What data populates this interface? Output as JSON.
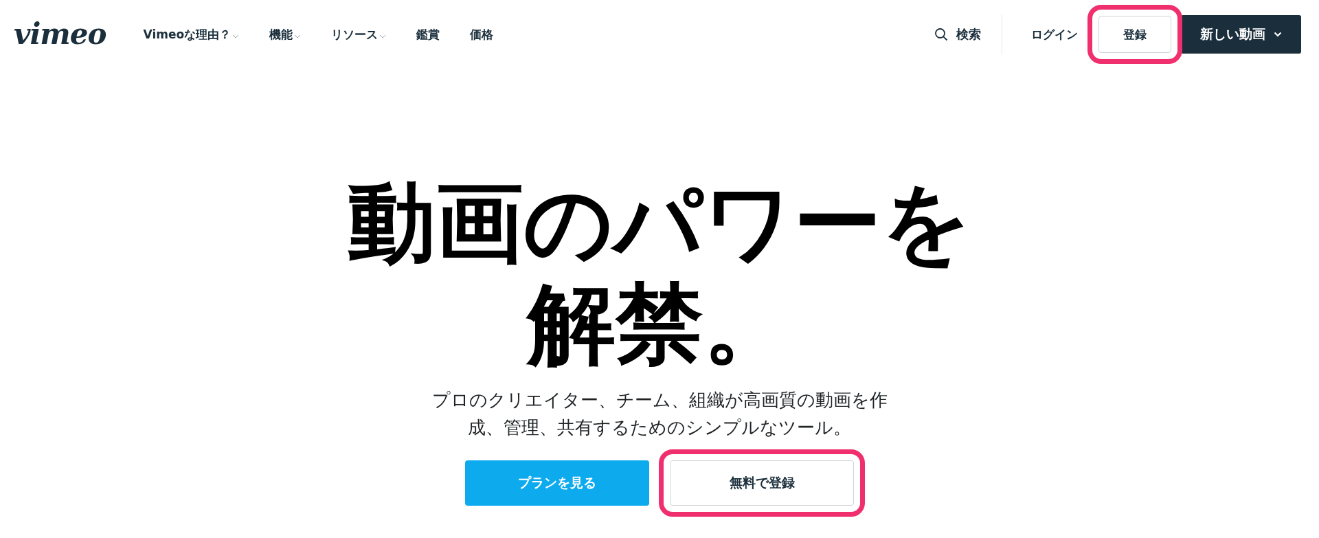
{
  "header": {
    "logo": "vimeo",
    "nav": [
      {
        "label": "Vimeoな理由？",
        "dropdown": true
      },
      {
        "label": "機能",
        "dropdown": true
      },
      {
        "label": "リソース",
        "dropdown": true
      },
      {
        "label": "鑑賞",
        "dropdown": false
      },
      {
        "label": "価格",
        "dropdown": false
      }
    ],
    "search": "検索",
    "login": "ログイン",
    "signup": {
      "label": "登録",
      "highlighted": true
    },
    "new_video": "新しい動画"
  },
  "hero": {
    "title_lines": [
      "動画のパワーを",
      "解禁。"
    ],
    "subtitle": "プロのクリエイター、チーム、組織が高画質の動画を作成、管理、共有するためのシンプルなツール。",
    "buttons": [
      {
        "label": "プランを見る",
        "kind": "primary",
        "highlighted": false
      },
      {
        "label": "無料で登録",
        "kind": "secondary",
        "highlighted": true
      }
    ]
  }
}
